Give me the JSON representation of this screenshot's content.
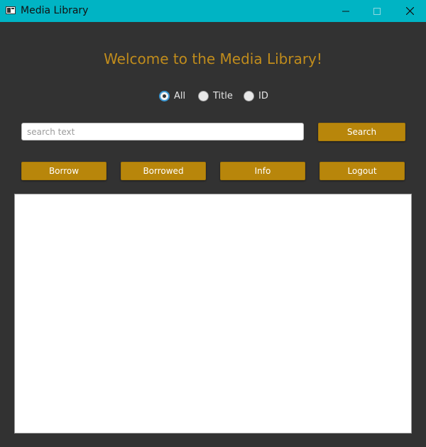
{
  "window": {
    "title": "Media Library",
    "icon": "app-window-icon",
    "controls": [
      "minimize-icon",
      "maximize-icon",
      "close-icon"
    ],
    "titlebar_color": "#00b4c4"
  },
  "main": {
    "heading": "Welcome to the Media Library!",
    "heading_color": "#c08c1c",
    "search_filter": {
      "options": [
        {
          "label": "All",
          "checked": true
        },
        {
          "label": "Title",
          "checked": false
        },
        {
          "label": "ID",
          "checked": false
        }
      ]
    },
    "search": {
      "value": "",
      "placeholder": "search text",
      "button_label": "Search"
    },
    "actions": {
      "borrow_label": "Borrow",
      "borrowed_label": "Borrowed",
      "info_label": "Info",
      "logout_label": "Logout"
    },
    "accent_color": "#b8860b",
    "background_color": "#323232",
    "results": []
  }
}
